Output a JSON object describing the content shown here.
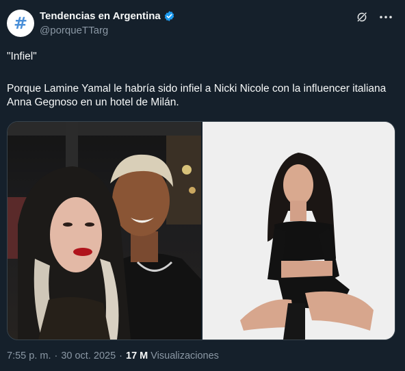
{
  "account": {
    "display_name": "Tendencias en Argentina",
    "handle": "@porqueTTarg",
    "avatar_glyph": "#",
    "verified": true
  },
  "tweet": {
    "quote": "\"Infiel\"",
    "body": "Porque Lamine Yamal le habría sido infiel a Nicki Nicole con la influencer italiana Anna Gegnoso en un hotel de Milán."
  },
  "media": {
    "images": [
      {
        "name": "couple-selfie-photo"
      },
      {
        "name": "woman-posing-photo"
      }
    ]
  },
  "meta": {
    "time": "7:55 p. m.",
    "separator": "·",
    "date": "30 oct. 2025",
    "views_count": "17 M",
    "views_label": "Visualizaciones"
  },
  "icons": [
    "grok-icon",
    "more-options-icon",
    "verified-badge-icon"
  ],
  "colors": {
    "background": "#15202b",
    "text_primary": "#f7f9f9",
    "text_secondary": "#8b98a5",
    "verified_blue": "#1d9bf0",
    "border": "#38444d"
  }
}
